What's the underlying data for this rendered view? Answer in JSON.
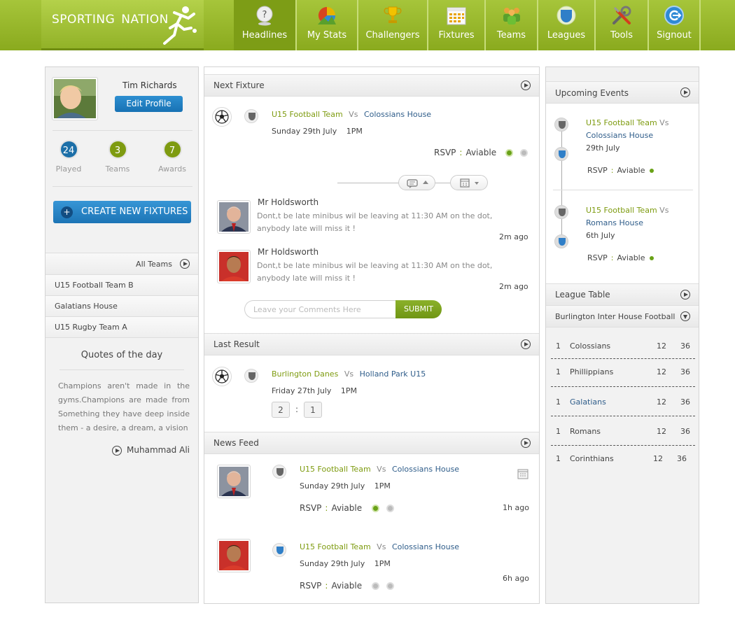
{
  "brand": {
    "word1": "SPORTING",
    "word2": "NATION"
  },
  "nav": [
    {
      "label": "Headlines",
      "icon": "headlines-icon",
      "active": true
    },
    {
      "label": "My Stats",
      "icon": "stats-icon",
      "active": false
    },
    {
      "label": "Challengers",
      "icon": "trophy-icon",
      "active": false
    },
    {
      "label": "Fixtures",
      "icon": "calendar-icon",
      "active": false
    },
    {
      "label": "Teams",
      "icon": "teams-icon",
      "active": false
    },
    {
      "label": "Leagues",
      "icon": "shield-icon",
      "active": false
    },
    {
      "label": "Tools",
      "icon": "tools-icon",
      "active": false
    },
    {
      "label": "Signout",
      "icon": "signout-icon",
      "active": false
    }
  ],
  "profile": {
    "name": "Tim Richards",
    "edit_label": "Edit Profile",
    "stats": [
      {
        "value": "24",
        "label": "Played",
        "color": "#1c6fa8"
      },
      {
        "value": "3",
        "label": "Teams",
        "color": "#7e9b10"
      },
      {
        "value": "7",
        "label": "Awards",
        "color": "#7e9b10"
      }
    ]
  },
  "create_fixture_label": "CREATE NEW FIXTURES",
  "teams": {
    "header": "All Teams",
    "items": [
      "U15 Football Team B",
      "Galatians House",
      "U15 Rugby Team A"
    ]
  },
  "quote": {
    "title": "Quotes of the day",
    "text": "Champions aren't made in the gyms.Champions are made from Something they have deep inside them - a desire, a dream, a vision",
    "author": "Muhammad Ali"
  },
  "next_fixture": {
    "header": "Next Fixture",
    "home": "U15 Football Team",
    "vs": "Vs",
    "away": "Colossians House",
    "date": "Sunday 29th  July",
    "time": "1PM",
    "rsvp_label": "RSVP",
    "rsvp_value": "Aviable"
  },
  "comments": [
    {
      "name": "Mr Holdsworth",
      "text": "Dont,t be late minibus wil be leaving at 11:30 AM on the dot, anybody late will miss it !",
      "time": "2m ago"
    },
    {
      "name": "Mr Holdsworth",
      "text": "Dont,t be late minibus wil be leaving at 11:30 AM on the dot, anybody late will miss it !",
      "time": "2m ago"
    }
  ],
  "comment_form": {
    "placeholder": "Leave your Comments Here",
    "submit_label": "SUBMIT"
  },
  "last_result": {
    "header": "Last Result",
    "home": "Burlington Danes",
    "vs": "Vs",
    "away": "Holland Park U15",
    "date": "Friday 27th  July",
    "time": "1PM",
    "score_home": "2",
    "score_sep": ":",
    "score_away": "1"
  },
  "news_feed": {
    "header": "News Feed",
    "items": [
      {
        "home": "U15 Football Team",
        "vs": "Vs",
        "away": "Colossians House",
        "date": "Sunday 29th  July",
        "time": "1PM",
        "rsvp_label": "RSVP",
        "rsvp_value": "Aviable",
        "ago": "1h ago"
      },
      {
        "home": "U15 Football Team",
        "vs": "Vs",
        "away": "Colossians House",
        "date": "Sunday 29th  July",
        "time": "1PM",
        "rsvp_label": "RSVP",
        "rsvp_value": "Aviable",
        "ago": "6h ago"
      }
    ]
  },
  "upcoming": {
    "header": "Upcoming Events",
    "items": [
      {
        "home": "U15 Football Team",
        "vs": "Vs",
        "away": "Colossians House",
        "date": "29th  July",
        "rsvp_label": "RSVP",
        "rsvp_value": "Aviable"
      },
      {
        "home": "U15 Football Team",
        "vs": "Vs",
        "away": "Romans House",
        "date": "6th  July",
        "rsvp_label": "RSVP",
        "rsvp_value": "Aviable"
      }
    ]
  },
  "league": {
    "header": "League Table",
    "selected": "Burlington Inter House Football",
    "rows": [
      {
        "rank": "1",
        "team": "Colossians",
        "played": "12",
        "points": "36",
        "highlight": false
      },
      {
        "rank": "1",
        "team": "Phillippians",
        "played": "12",
        "points": "36",
        "highlight": false
      },
      {
        "rank": "1",
        "team": "Galatians",
        "played": "12",
        "points": "36",
        "highlight": true
      },
      {
        "rank": "1",
        "team": "Romans",
        "played": "12",
        "points": "36",
        "highlight": false
      },
      {
        "rank": "1",
        "team": "Corinthians",
        "played": "12",
        "points": "36",
        "highlight": false
      }
    ]
  }
}
